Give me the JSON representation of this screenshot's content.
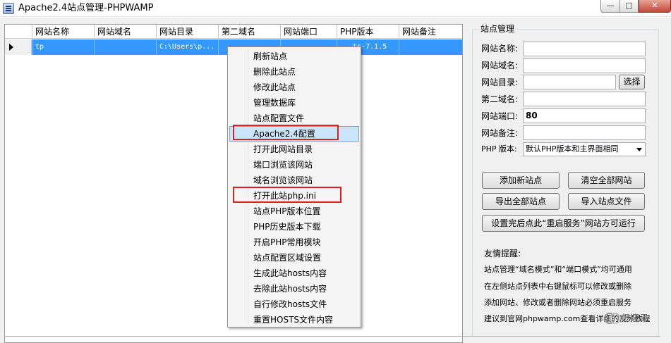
{
  "window": {
    "title": "Apache2.4站点管理-PHPWAMP",
    "minimize_glyph": "—",
    "maximize_glyph": "□",
    "close_glyph": "✕"
  },
  "grid": {
    "columns": [
      "网站名称",
      "网站域名",
      "网站目录",
      "第二域名",
      "网站端口",
      "PHP版本",
      "网站备注"
    ],
    "rows": [
      {
        "name": "tp",
        "domain": "",
        "dir": "C:\\Users\\p...",
        "second_domain": "",
        "port": "",
        "php": "...ts-7.1.5",
        "note": ""
      }
    ]
  },
  "context_menu": {
    "items": [
      "刷新站点",
      "删除此站点",
      "修改此站点",
      "管理数据库",
      "站点配置文件",
      "Apache2.4配置",
      "打开此网站目录",
      "端口浏览该网站",
      "域名浏览该网站",
      "打开此站php.ini",
      "站点PHP版本位置",
      "PHP历史版本下载",
      "开启PHP常用模块",
      "站点配置区域设置",
      "生成此站hosts内容",
      "去除此站hosts内容",
      "自行修改hosts文件",
      "重置HOSTS文件内容"
    ],
    "highlighted_index": 5,
    "annotated_indices": [
      5,
      9
    ]
  },
  "site_panel": {
    "title": "站点管理",
    "fields": {
      "name_label": "网站名称:",
      "name_value": "",
      "domain_label": "网站域名:",
      "domain_value": "",
      "dir_label": "网站目录:",
      "dir_value": "",
      "browse_button": "选择",
      "second_domain_label": "第二域名:",
      "second_domain_value": "",
      "port_label": "网站端口:",
      "port_value": "80",
      "note_label": "网站备注:",
      "note_value": "",
      "php_label": "PHP 版本:",
      "php_value": "默认PHP版本和主界面相同"
    },
    "buttons": {
      "add_site": "添加新站点",
      "clear_all": "清空全部网站",
      "export_all": "导出全部站点",
      "import": "导入站点文件",
      "restart_hint": "设置完后点此“重启服务”网站方可运行"
    },
    "tips": {
      "title": "友情提醒:",
      "lines": [
        "站点管理“域名模式”和“端口模式”均可通用",
        "在左侧站点列表中右键鼠标可以修改或删除",
        "添加网站、修改或者删除网站必须重启服务",
        "建议到官网phpwamp.com查看详细的视频教程"
      ]
    }
  },
  "watermark": {
    "text": "亿速云"
  },
  "colors": {
    "selection": "#3399ff",
    "menu_highlight": "#cbe5fb",
    "annotation_red": "#e0201f",
    "close_button": "#c3473a"
  }
}
